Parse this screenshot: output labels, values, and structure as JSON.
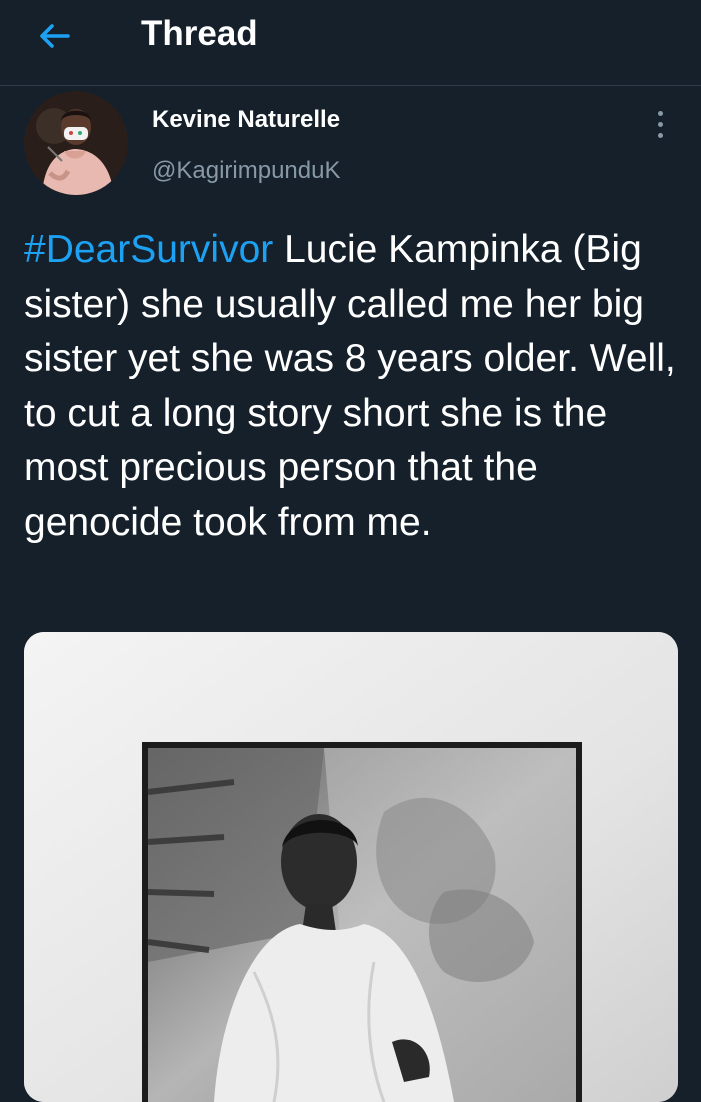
{
  "header": {
    "title": "Thread",
    "back_icon": "arrow-left-icon"
  },
  "tweet": {
    "author_name": "Kevine Naturelle",
    "author_handle": "@KagirimpunduK",
    "more_icon": "more-vertical-icon",
    "hashtag": "#DearSurvivor",
    "body": " Lucie Kampinka (Big sister) she usually called me her big sister yet she was 8 years older. Well, to cut a long story short she is the most precious person that the genocide took from me."
  },
  "colors": {
    "background": "#15202b",
    "accent": "#1da1f2",
    "secondary_text": "#8899a6",
    "divider": "#2f3b47"
  }
}
